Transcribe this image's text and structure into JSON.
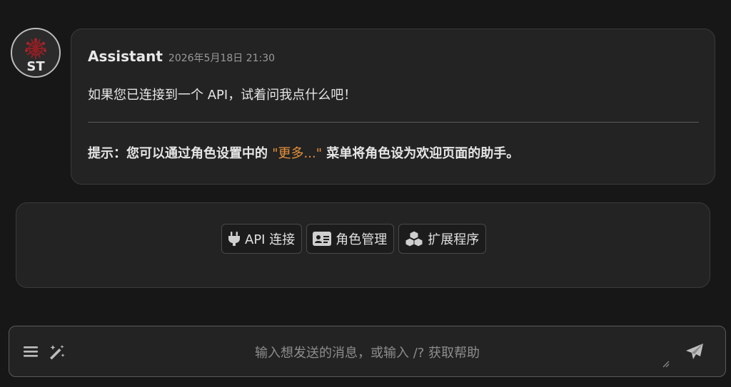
{
  "avatar": {
    "label": "ST",
    "icon": "sillytavern-logo"
  },
  "message": {
    "name": "Assistant",
    "timestamp": "2026年5月18日 21:30",
    "line1": "如果您已连接到一个 API，试着问我点什么吧！",
    "hint_prefix": "提示：您可以通过角色设置中的 ",
    "hint_quote": "\"更多...\"",
    "hint_suffix": " 菜单将角色设为欢迎页面的助手。",
    "accent_color": "#e6913a"
  },
  "panel": {
    "buttons": [
      {
        "label": "API 连接",
        "icon": "plug-icon"
      },
      {
        "label": "角色管理",
        "icon": "id-card-icon"
      },
      {
        "label": "扩展程序",
        "icon": "cubes-icon"
      }
    ]
  },
  "input": {
    "placeholder": "输入想发送的消息，或输入 /? 获取帮助",
    "icons": [
      "menu-icon",
      "magic-wand-icon",
      "send-icon"
    ]
  }
}
